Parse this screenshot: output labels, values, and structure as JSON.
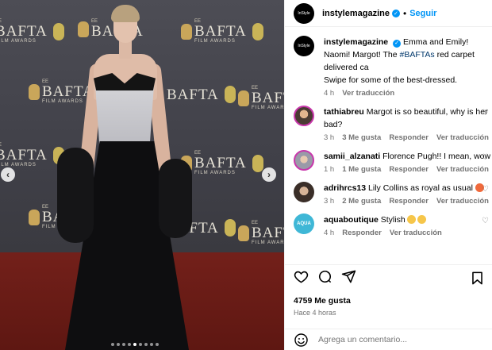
{
  "post": {
    "username": "instylemagazine",
    "avatar_text": "InStyle",
    "follow_label": "Seguir",
    "separator": "•"
  },
  "photo": {
    "logo_text": "BAFTA",
    "logo_sub": "FILM AWARDS",
    "ee": "EE",
    "current_slide": 5,
    "slide_count": 9
  },
  "comments": [
    {
      "username": "instylemagazine",
      "text": "Emma and Emily! Naomi! Margot! The ",
      "hashtag": "#BAFTAs",
      "text_after": " red carpet delivered ca",
      "text_line2": "Swipe for some of the best-dressed.",
      "time": "4 h",
      "translate": "Ver traducción"
    },
    {
      "username": "tathiabreu",
      "text": "Margot is so beautiful, why is her",
      "text_line2": "bad?",
      "time": "3 h",
      "likes": "3 Me gusta",
      "reply": "Responder",
      "translate": "Ver traducción"
    },
    {
      "username": "samii_alzanati",
      "text": "Florence Pugh!! I mean, wow!!",
      "time": "1 h",
      "likes": "1 Me gusta",
      "reply": "Responder",
      "translate": "Ver traducción"
    },
    {
      "username": "adrihrcs13",
      "text": "Lily Collins as royal as usual",
      "time": "3 h",
      "likes": "2 Me gusta",
      "reply": "Responder",
      "translate": "Ver traducción"
    },
    {
      "username": "aquaboutique",
      "avatar_text": "AQUA",
      "text": "Stylish",
      "time": "4 h",
      "reply": "Responder",
      "translate": "Ver traducción"
    }
  ],
  "footer": {
    "likes": "4759 Me gusta",
    "time": "Hace 4 horas",
    "comment_placeholder": "Agrega un comentario..."
  },
  "colors": {
    "accent": "#0095f6",
    "hashtag": "#00376b",
    "muted": "#737373"
  }
}
